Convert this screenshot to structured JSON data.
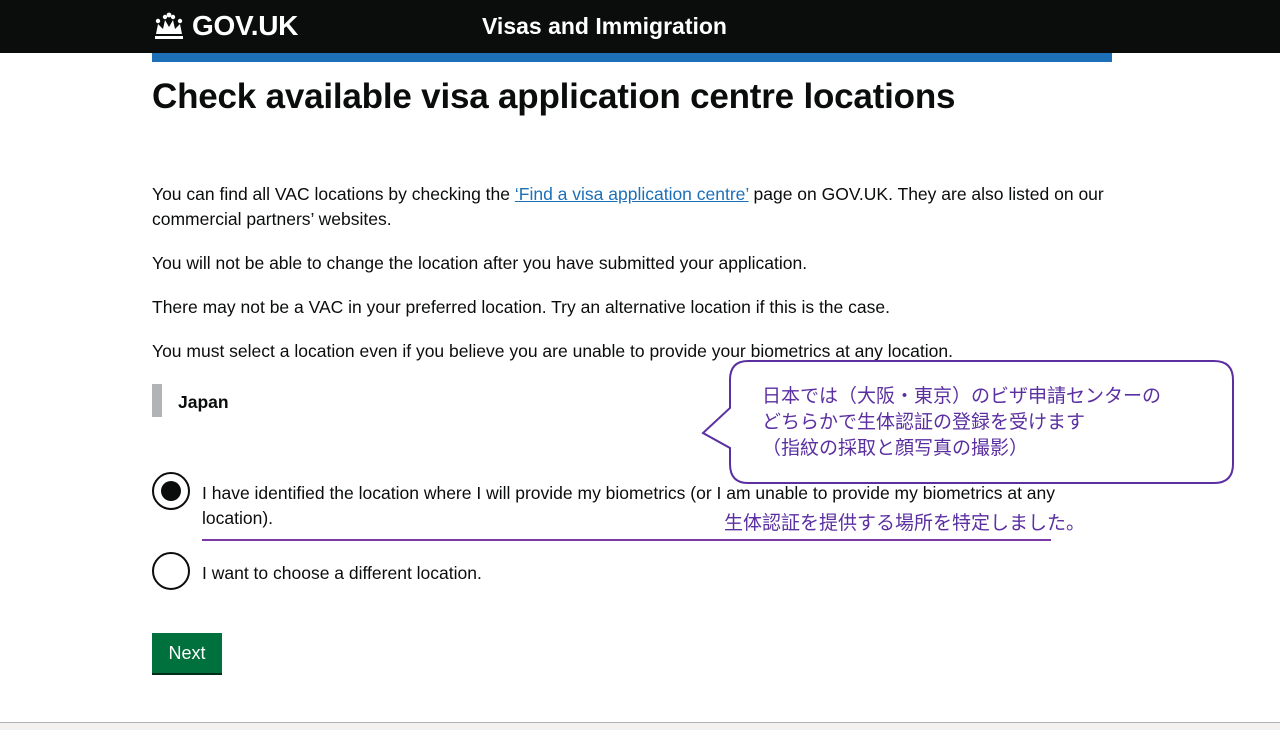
{
  "header": {
    "logo_text": "GOV.UK",
    "service_name": "Visas and Immigration"
  },
  "page": {
    "title": "Check available visa application centre locations",
    "p1_before": "You can find all VAC locations by checking the ",
    "p1_link": "‘Find a visa application centre’",
    "p1_after": " page on GOV.UK. They are also listed on our commercial partners’ websites.",
    "p2": "You will not be able to change the location after you have submitted your application.",
    "p3": "There may not be a VAC in your preferred location. Try an alternative location if this is the case.",
    "p4": "You must select a location even if you believe you are unable to provide your biometrics at any location.",
    "country": "Japan"
  },
  "radios": [
    {
      "label": "I have identified the location where I will provide my biometrics (or I am unable to provide my biometrics at any location).",
      "checked": true
    },
    {
      "label": "I want to choose a different location.",
      "checked": false
    }
  ],
  "next_button": "Next",
  "annotations": {
    "callout_line1": "日本では（大阪・東京）のビザ申請センターの",
    "callout_line2": "どちらかで生体認証の登録を受けます",
    "callout_line3": "（指紋の採取と顔写真の撮影）",
    "underline_note": "生体認証を提供する場所を特定しました。",
    "color": "#5b2fa0"
  },
  "colors": {
    "header_bg": "#0b0c0c",
    "blue_bar": "#1d70b8",
    "link": "#1d70b8",
    "button": "#00703c",
    "inset_border": "#b1b4b6"
  }
}
